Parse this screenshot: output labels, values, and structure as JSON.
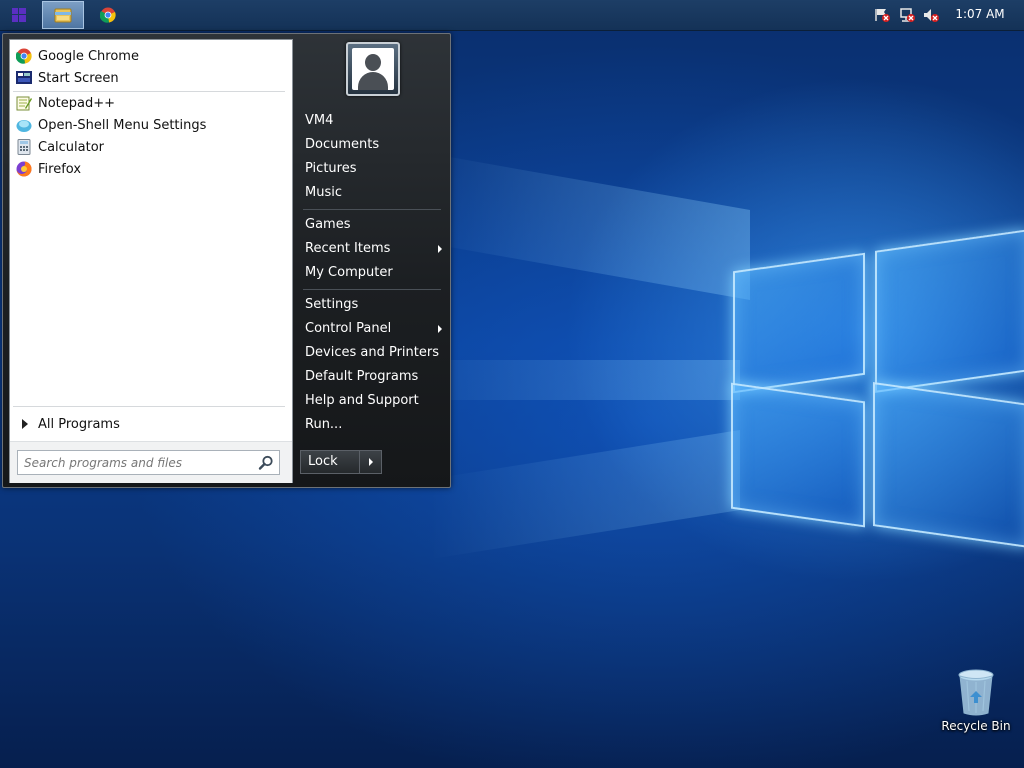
{
  "taskbar": {
    "clock": "1:07 AM",
    "buttons": [
      "start-button",
      "file-explorer",
      "google-chrome"
    ]
  },
  "start_menu": {
    "pinned": [
      {
        "label": "Google Chrome",
        "icon": "chrome-icon"
      },
      {
        "label": "Start Screen",
        "icon": "start-screen-icon"
      }
    ],
    "recent": [
      {
        "label": "Notepad++",
        "icon": "notepadpp-icon"
      },
      {
        "label": "Open-Shell Menu Settings",
        "icon": "open-shell-icon"
      },
      {
        "label": "Calculator",
        "icon": "calculator-icon"
      },
      {
        "label": "Firefox",
        "icon": "firefox-icon"
      }
    ],
    "all_programs": "All Programs",
    "search": {
      "placeholder": "Search programs and files",
      "value": ""
    },
    "right": [
      {
        "label": "VM4"
      },
      {
        "label": "Documents"
      },
      {
        "label": "Pictures"
      },
      {
        "label": "Music"
      },
      {
        "label": "Games"
      },
      {
        "label": "Recent Items",
        "submenu": true
      },
      {
        "label": "My Computer"
      },
      {
        "label": "Settings"
      },
      {
        "label": "Control Panel",
        "submenu": true
      },
      {
        "label": "Devices and Printers"
      },
      {
        "label": "Default Programs"
      },
      {
        "label": "Help and Support"
      },
      {
        "label": "Run..."
      }
    ],
    "power_button": "Lock"
  },
  "desktop": {
    "icons": [
      {
        "label": "Recycle Bin",
        "icon": "recycle-bin-icon"
      }
    ]
  },
  "colors": {
    "taskbar": "#143257",
    "menu_dark": "#1c1f22",
    "menu_light": "#ffffff",
    "wallpaper": "#0a3d8f"
  }
}
